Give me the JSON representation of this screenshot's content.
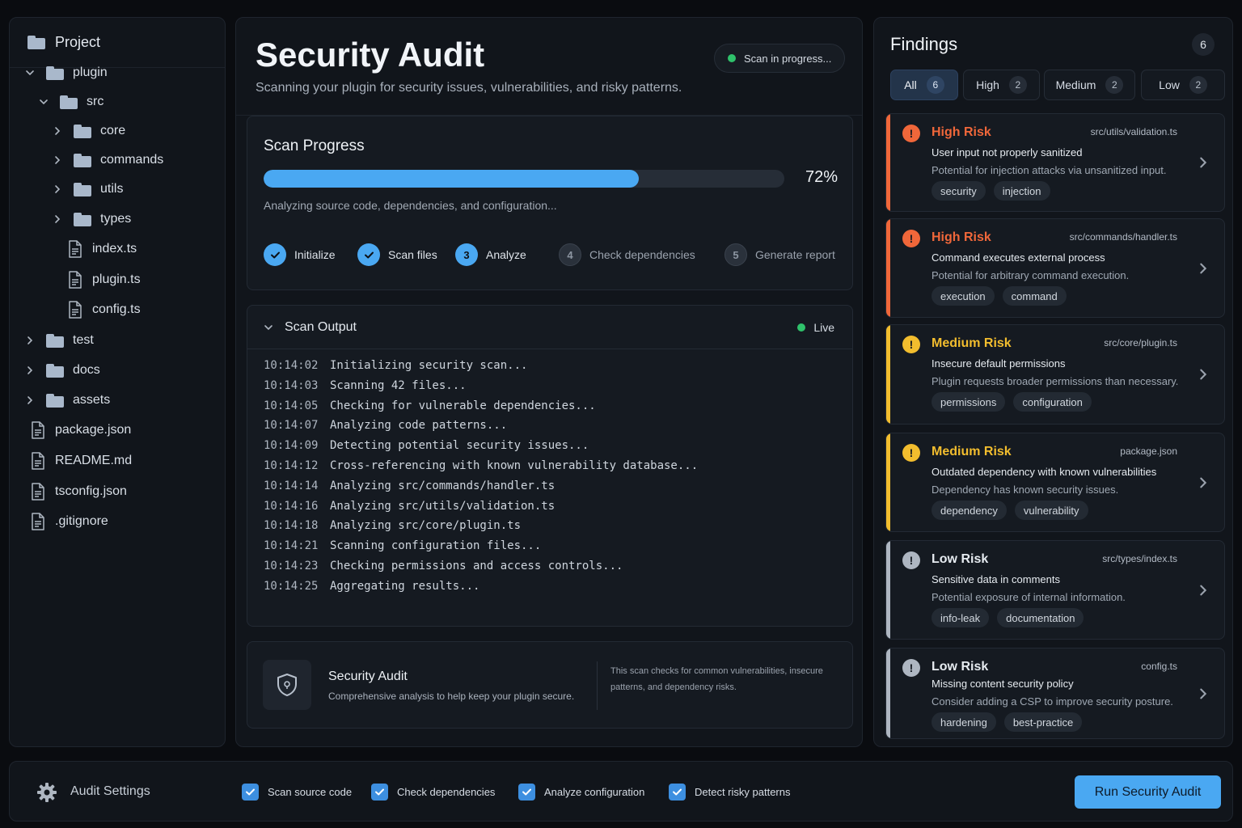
{
  "sidebar": {
    "title": "Project",
    "tree": [
      {
        "label": "plugin",
        "type": "folder",
        "expanded": true
      },
      {
        "label": "src",
        "type": "folder",
        "expanded": true
      },
      {
        "label": "core",
        "type": "folder",
        "expanded": false
      },
      {
        "label": "commands",
        "type": "folder",
        "expanded": false
      },
      {
        "label": "utils",
        "type": "folder",
        "expanded": false
      },
      {
        "label": "types",
        "type": "folder",
        "expanded": false
      },
      {
        "label": "index.ts",
        "type": "file"
      },
      {
        "label": "plugin.ts",
        "type": "file"
      },
      {
        "label": "config.ts",
        "type": "file"
      },
      {
        "label": "test",
        "type": "folder",
        "expanded": false
      },
      {
        "label": "docs",
        "type": "folder",
        "expanded": false
      },
      {
        "label": "assets",
        "type": "folder",
        "expanded": false
      },
      {
        "label": "package.json",
        "type": "file"
      },
      {
        "label": "README.md",
        "type": "file"
      },
      {
        "label": "tsconfig.json",
        "type": "file"
      },
      {
        "label": ".gitignore",
        "type": "file"
      }
    ]
  },
  "main": {
    "title": "Security Audit",
    "subtitle": "Scanning your plugin for security issues, vulnerabilities, and risky patterns.",
    "status": "Scan in progress...",
    "progress": {
      "title": "Scan Progress",
      "percent_label": "72%",
      "fraction": 0.72,
      "text": "Analyzing source code, dependencies, and configuration...",
      "steps": [
        {
          "label": "Initialize",
          "state": "done",
          "num": "1"
        },
        {
          "label": "Scan files",
          "state": "done",
          "num": "2"
        },
        {
          "label": "Analyze",
          "state": "active",
          "num": "3"
        },
        {
          "label": "Check dependencies",
          "state": "pending",
          "num": "4"
        },
        {
          "label": "Generate report",
          "state": "pending",
          "num": "5"
        }
      ]
    },
    "output": {
      "title": "Scan Output",
      "live": "Live",
      "lines": [
        {
          "ts": "10:14:02",
          "msg": "Initializing security scan..."
        },
        {
          "ts": "10:14:03",
          "msg": "Scanning 42 files..."
        },
        {
          "ts": "10:14:05",
          "msg": "Checking for vulnerable dependencies..."
        },
        {
          "ts": "10:14:07",
          "msg": "Analyzing code patterns..."
        },
        {
          "ts": "10:14:09",
          "msg": "Detecting potential security issues..."
        },
        {
          "ts": "10:14:12",
          "msg": "Cross-referencing with known vulnerability database..."
        },
        {
          "ts": "10:14:14",
          "msg": "Analyzing src/commands/handler.ts"
        },
        {
          "ts": "10:14:16",
          "msg": "Analyzing src/utils/validation.ts"
        },
        {
          "ts": "10:14:18",
          "msg": "Analyzing src/core/plugin.ts"
        },
        {
          "ts": "10:14:21",
          "msg": "Scanning configuration files..."
        },
        {
          "ts": "10:14:23",
          "msg": "Checking permissions and access controls..."
        },
        {
          "ts": "10:14:25",
          "msg": "Aggregating results..."
        }
      ]
    },
    "info": {
      "title": "Security Audit",
      "desc": "Comprehensive analysis to help keep your plugin secure.",
      "note": "This scan checks for common vulnerabilities, insecure patterns, and dependency risks."
    }
  },
  "findings": {
    "title": "Findings",
    "count": "6",
    "filters": [
      {
        "label": "All",
        "count": "6",
        "active": true
      },
      {
        "label": "High",
        "count": "2",
        "active": false
      },
      {
        "label": "Medium",
        "count": "2",
        "active": false
      },
      {
        "label": "Low",
        "count": "2",
        "active": false
      }
    ],
    "items": [
      {
        "severity": "High Risk",
        "level": "high",
        "path": "src/utils/validation.ts",
        "heading": "User input not properly sanitized",
        "desc": "Potential for injection attacks via unsanitized input.",
        "tags": [
          "security",
          "injection"
        ]
      },
      {
        "severity": "High Risk",
        "level": "high",
        "path": "src/commands/handler.ts",
        "heading": "Command executes external process",
        "desc": "Potential for arbitrary command execution.",
        "tags": [
          "execution",
          "command"
        ]
      },
      {
        "severity": "Medium Risk",
        "level": "medium",
        "path": "src/core/plugin.ts",
        "heading": "Insecure default permissions",
        "desc": "Plugin requests broader permissions than necessary.",
        "tags": [
          "permissions",
          "configuration"
        ]
      },
      {
        "severity": "Medium Risk",
        "level": "medium",
        "path": "package.json",
        "heading": "Outdated dependency with known vulnerabilities",
        "desc": "Dependency has known security issues.",
        "tags": [
          "dependency",
          "vulnerability"
        ]
      },
      {
        "severity": "Low Risk",
        "level": "low",
        "path": "src/types/index.ts",
        "heading": "Sensitive data in comments",
        "desc": "Potential exposure of internal information.",
        "tags": [
          "info-leak",
          "documentation"
        ]
      },
      {
        "severity": "Low Risk",
        "level": "low",
        "path": "config.ts",
        "heading": "Missing content security policy",
        "desc": "Consider adding a CSP to improve security posture.",
        "tags": [
          "hardening",
          "best-practice"
        ]
      }
    ]
  },
  "footer": {
    "settings_label": "Audit Settings",
    "options": [
      {
        "label": "Scan source code",
        "checked": true
      },
      {
        "label": "Check dependencies",
        "checked": true
      },
      {
        "label": "Analyze configuration",
        "checked": true
      },
      {
        "label": "Detect risky patterns",
        "checked": true
      }
    ],
    "run_label": "Run Security Audit"
  },
  "colors": {
    "accent": "#4aa8f2",
    "high": "#f0673a",
    "medium": "#f2bd2e",
    "low": "#aeb6c1",
    "live": "#2fc26b"
  },
  "icons": {
    "folder": "folder-icon",
    "file": "file-icon",
    "shield": "shield-icon",
    "gear": "gear-icon",
    "check": "check-icon",
    "chevron": "chevron-right-icon"
  }
}
